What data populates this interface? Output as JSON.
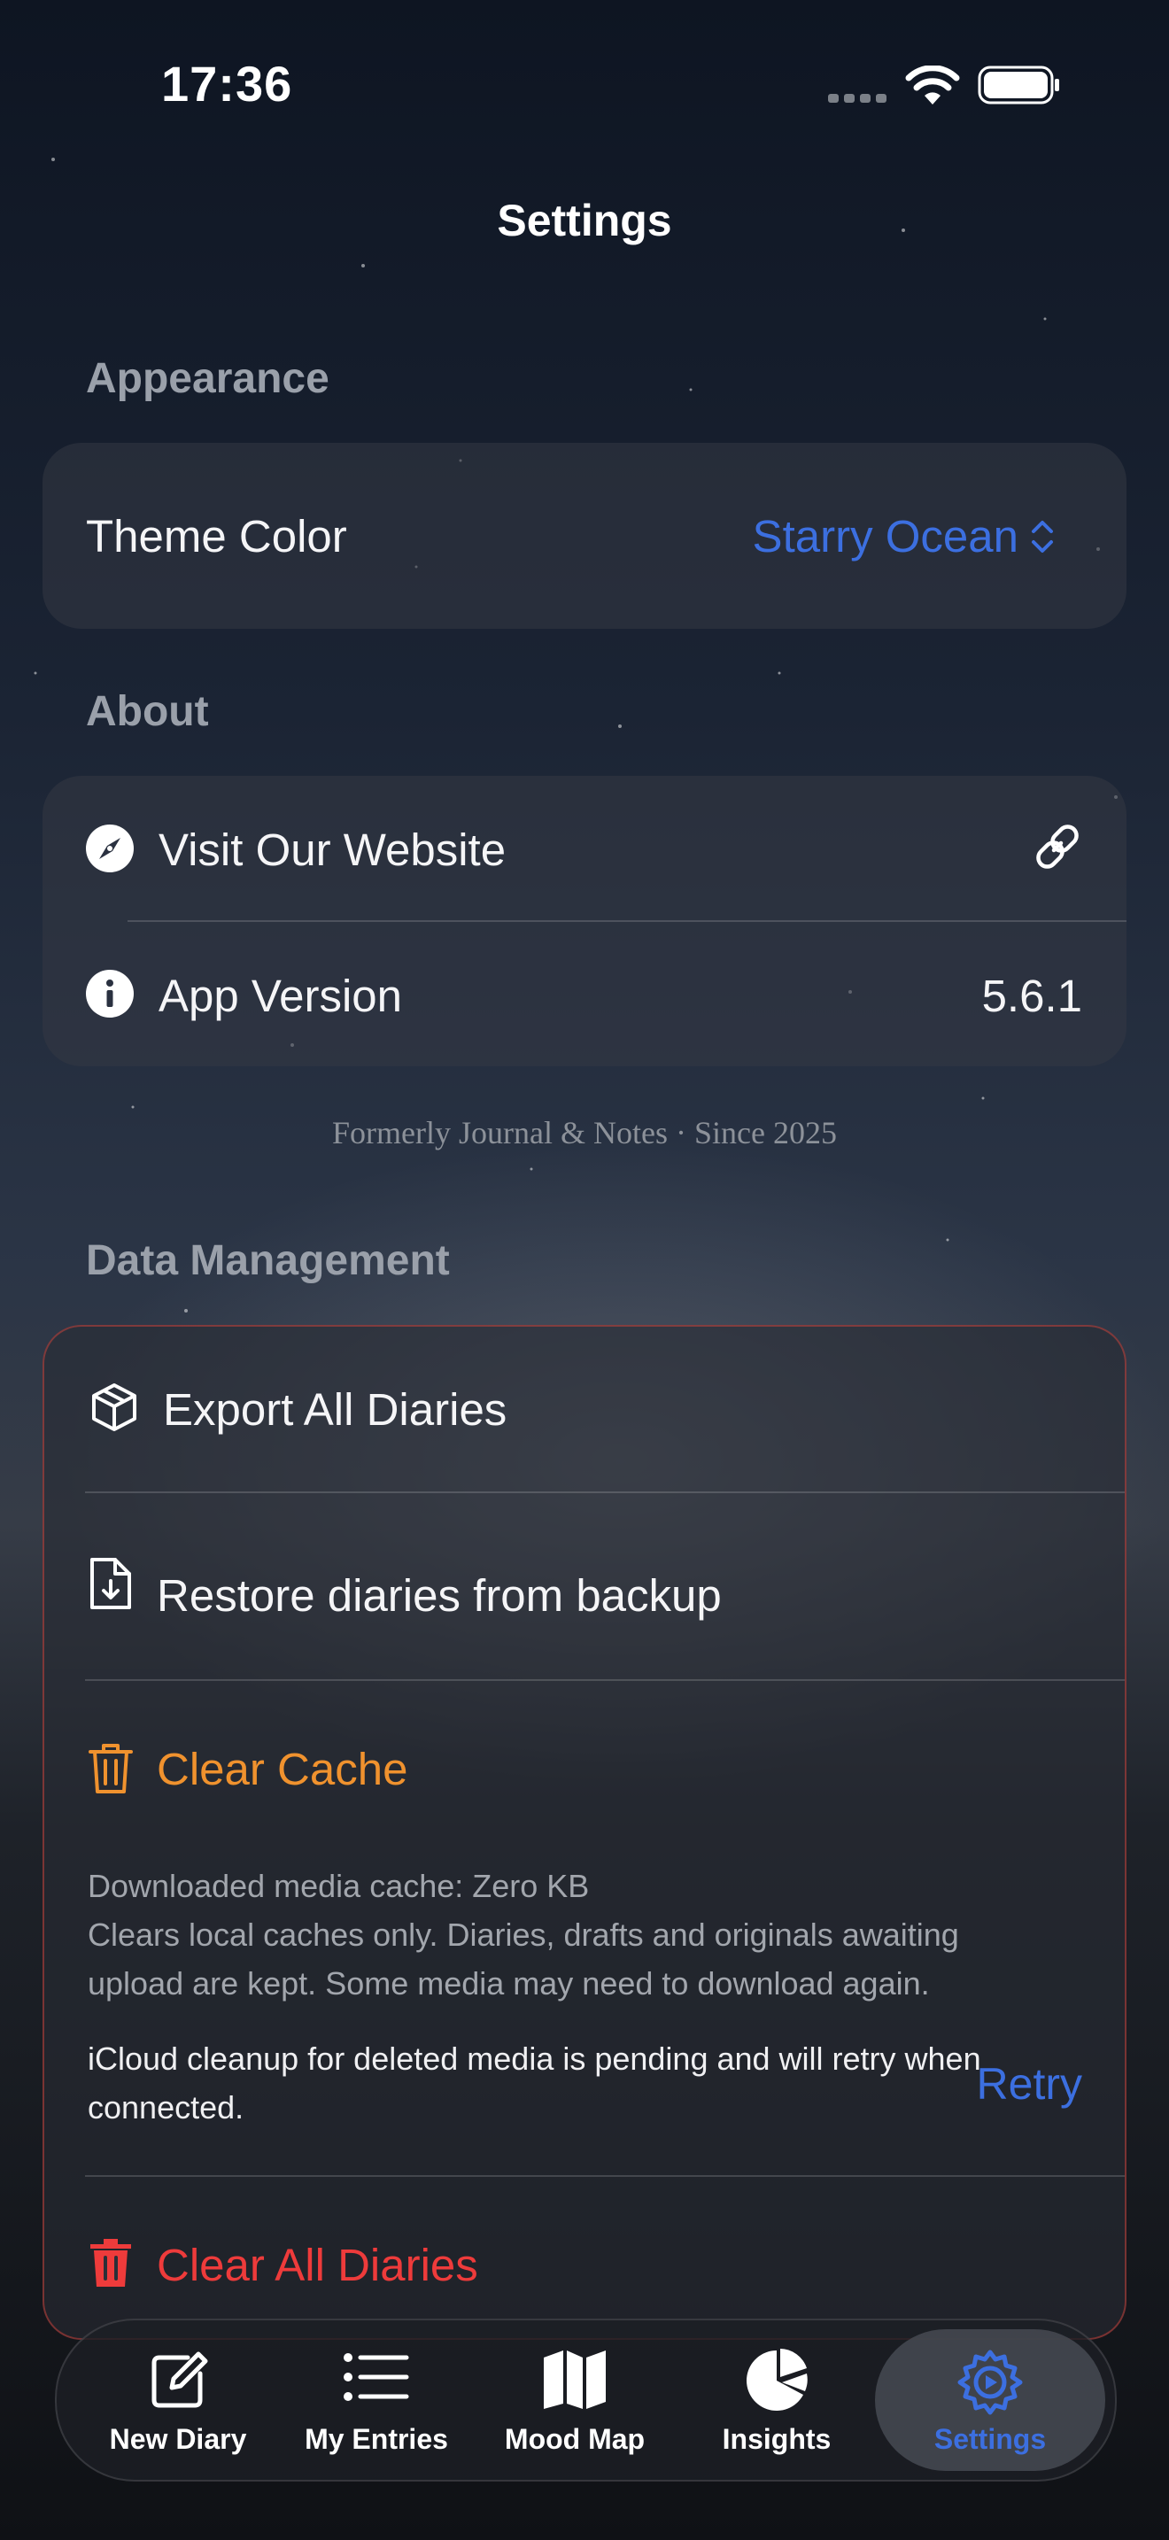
{
  "status_bar": {
    "time": "17:36"
  },
  "nav": {
    "title": "Settings"
  },
  "appearance": {
    "header": "Appearance",
    "theme_label": "Theme Color",
    "theme_value": "Starry Ocean"
  },
  "about": {
    "header": "About",
    "website_label": "Visit Our Website",
    "version_label": "App Version",
    "version_value": "5.6.1",
    "footnote": "Formerly Journal & Notes · Since 2025"
  },
  "data_management": {
    "header": "Data Management",
    "export_label": "Export All Diaries",
    "restore_label": "Restore diaries from backup",
    "clear_cache_label": "Clear Cache",
    "cache_size": "Downloaded media cache: Zero KB",
    "cache_info": "Clears local caches only. Diaries, drafts and originals awaiting upload are kept. Some media may need to download again.",
    "icloud_notice": "iCloud cleanup for deleted media is pending and will retry when connected.",
    "retry_label": "Retry",
    "clear_all_label": "Clear All Diaries"
  },
  "tabs": [
    {
      "label": "New Diary",
      "icon": "compose-icon"
    },
    {
      "label": "My Entries",
      "icon": "list-icon"
    },
    {
      "label": "Mood Map",
      "icon": "map-icon"
    },
    {
      "label": "Insights",
      "icon": "pie-chart-icon"
    },
    {
      "label": "Settings",
      "icon": "gear-icon",
      "active": true
    }
  ],
  "colors": {
    "accent": "#3c6fe0",
    "warning": "#f0922e",
    "danger": "#ee3b3b"
  }
}
